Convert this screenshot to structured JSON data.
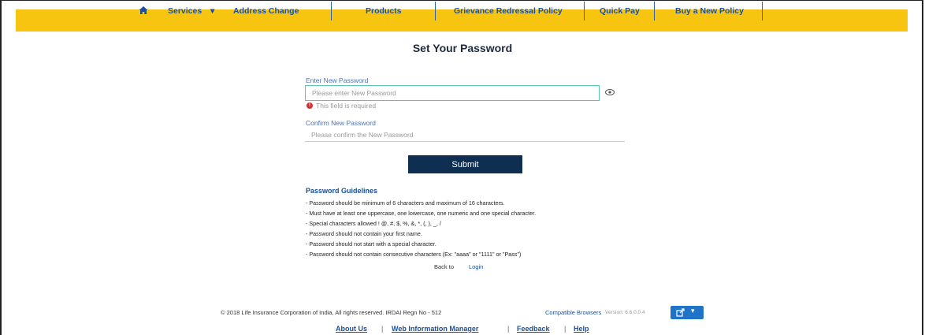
{
  "nav": {
    "services": "Services",
    "address_change": "Address Change",
    "products": "Products",
    "grievance": "Grievance Redressal Policy",
    "quick_pay": "Quick Pay",
    "buy_policy": "Buy a New Policy",
    "brand_color": "#f7c50f",
    "link_color": "#1a4f9c"
  },
  "page_title": "Set Your Password",
  "form": {
    "new_password_label": "Enter New Password",
    "new_password_placeholder": "Please enter New Password",
    "new_password_value": "",
    "error_text": "This field is required",
    "confirm_label": "Confirm New Password",
    "confirm_placeholder": "Please confirm the New Password",
    "confirm_value": "",
    "submit_label": "Submit"
  },
  "guidelines": {
    "title": "Password Guidelines",
    "items": [
      "- Password should be minimum of 6 characters and maximum of 16 characters.",
      "- Must have at least one uppercase, one lowercase, one numeric and one special character.",
      "- Special characters allowed ! @, #, $, %, &, *, (, ), _, /",
      "- Password should not contain your first name.",
      "- Password should not start with a special character.",
      "- Password should not contain consecutive characters (Ex: \"aaaa\" or \"1111\" or \"Pass\")"
    ]
  },
  "back_to": "Back to",
  "login_link": "Login",
  "footer": {
    "copyright": "© 2018 Life Insurance Corporation of India, All rights reserved. IRDAI Regn No - 512",
    "compatible": "Compatible Browsers",
    "version": "Version: 6.6.0.0.4",
    "links": {
      "about": "About Us",
      "wim": "Web Information Manager",
      "feedback": "Feedback",
      "help": "Help"
    }
  },
  "icons": {
    "home": "home-icon",
    "dropdown": "caret-down-icon",
    "eye": "eye-icon",
    "error": "exclamation-icon",
    "share": "share-icon"
  },
  "colors": {
    "submit_bg": "#0f2f52",
    "input_focus": "#5ac8a8",
    "error": "#d32f2f",
    "footer_button": "#1f73c9"
  }
}
